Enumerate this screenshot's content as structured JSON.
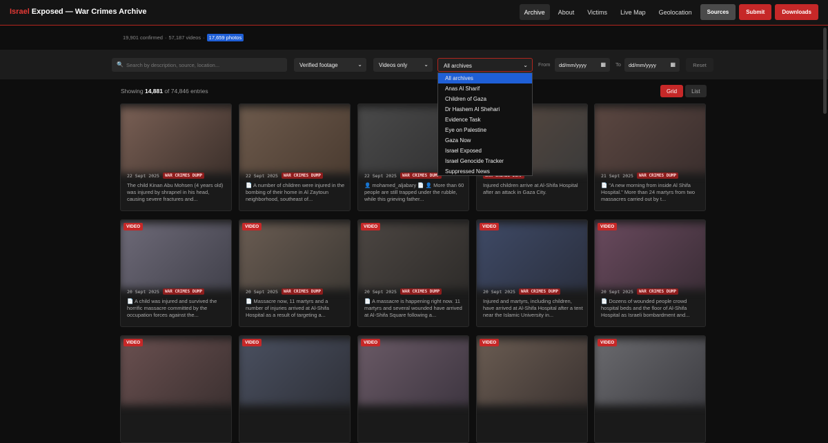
{
  "header": {
    "brand_red": "Israel",
    "brand_rest": " Exposed — War Crimes Archive",
    "nav": [
      "Archive",
      "About",
      "Victims",
      "Live Map",
      "Geolocation"
    ],
    "buttons": [
      "Sources",
      "Submit",
      "Downloads"
    ]
  },
  "stats": {
    "confirmed": "19,901 confirmed",
    "videos": "57,187 videos",
    "photos": "17,659 photos"
  },
  "filters": {
    "search_placeholder": "Search by description, source, location...",
    "footage": "Verified footage",
    "media": "Videos only",
    "archive": "All archives",
    "from_label": "From",
    "to_label": "To",
    "date_placeholder": "dd/mm/yyyy",
    "reset": "Reset"
  },
  "dropdown": [
    "All archives",
    "Anas Al Sharif",
    "Children of Gaza",
    "Dr Hashem Al Shehari",
    "Evidence Task",
    "Eye on Palestine",
    "Gaza Now",
    "Israel Exposed",
    "Israel Genocide Tracker",
    "Suppressed News"
  ],
  "results": {
    "prefix": "Showing ",
    "count": "14,881",
    "suffix": " of 74,846 entries",
    "grid": "Grid",
    "list": "List"
  },
  "tag": "WAR CRIMES DUMP",
  "video_badge": "VIDEO",
  "cards": [
    {
      "date": "22 Sept 2025",
      "video": false,
      "desc": "The child Kinan Abu Mohsen (4 years old) was injured by shrapnel in his head, causing severe fractures and...",
      "colors": [
        "#7a6055",
        "#3b2f2a"
      ]
    },
    {
      "date": "22 Sept 2025",
      "video": false,
      "desc": "📄 A number of children were injured in the bombing of their home in Al Zaytoun neighborhood, southeast of...",
      "colors": [
        "#6d5a4c",
        "#4a3b30"
      ]
    },
    {
      "date": "22 Sept 2025",
      "video": false,
      "desc": "👤 mohamed_aljabary 📄 👤 More than 60 people are still trapped under the rubble, while this grieving father...",
      "colors": [
        "#4a4a4a",
        "#2f2f30"
      ]
    },
    {
      "date": "",
      "video": false,
      "desc": "Injured children arrive at Al-Shifa Hospital after an attack in Gaza City.",
      "colors": [
        "#5a4a40",
        "#3a3a3a"
      ]
    },
    {
      "date": "21 Sept 2025",
      "video": false,
      "desc": "📄 \"A new morning from inside Al Shifa Hospital.\" More than 24 martyrs from two massacres carried out by t...",
      "colors": [
        "#5b4741",
        "#3a2e2d"
      ]
    },
    {
      "date": "20 Sept 2025",
      "video": true,
      "desc": "📄 A child was injured and survived the horrific massacre committed by the occupation forces against the...",
      "colors": [
        "#6e6a78",
        "#40404a"
      ]
    },
    {
      "date": "20 Sept 2025",
      "video": true,
      "desc": "📄 Massacre now, 11 martyrs and a number of injuries arrived at Al-Shifa Hospital as a result of targeting a...",
      "colors": [
        "#6a5c52",
        "#3d3934"
      ]
    },
    {
      "date": "20 Sept 2025",
      "video": true,
      "desc": "📄 A massacre is happening right now. 11 martyrs and several wounded have arrived at Al-Shifa Square following a...",
      "colors": [
        "#4c4642",
        "#2d2b29"
      ]
    },
    {
      "date": "20 Sept 2025",
      "video": true,
      "desc": "Injured and martyrs, including children, have arrived at Al-Shifa Hospital after a tent near the Islamic University in...",
      "colors": [
        "#3f4a66",
        "#2a2f3e"
      ]
    },
    {
      "date": "20 Sept 2025",
      "video": true,
      "desc": "📄 Dozens of wounded people crowd hospital beds and the floor of Al-Shifa Hospital as Israeli bombardment and...",
      "colors": [
        "#6a4a5e",
        "#3a2d36"
      ]
    },
    {
      "date": "",
      "video": true,
      "desc": "",
      "colors": [
        "#6a5050",
        "#3b3030"
      ]
    },
    {
      "date": "",
      "video": true,
      "desc": "",
      "colors": [
        "#4a5060",
        "#2e3038"
      ]
    },
    {
      "date": "",
      "video": true,
      "desc": "",
      "colors": [
        "#6a5a66",
        "#3d3540"
      ]
    },
    {
      "date": "",
      "video": true,
      "desc": "",
      "colors": [
        "#6a5c52",
        "#3a3230"
      ]
    },
    {
      "date": "",
      "video": true,
      "desc": "",
      "colors": [
        "#6a6a6e",
        "#3d3d42"
      ]
    }
  ]
}
